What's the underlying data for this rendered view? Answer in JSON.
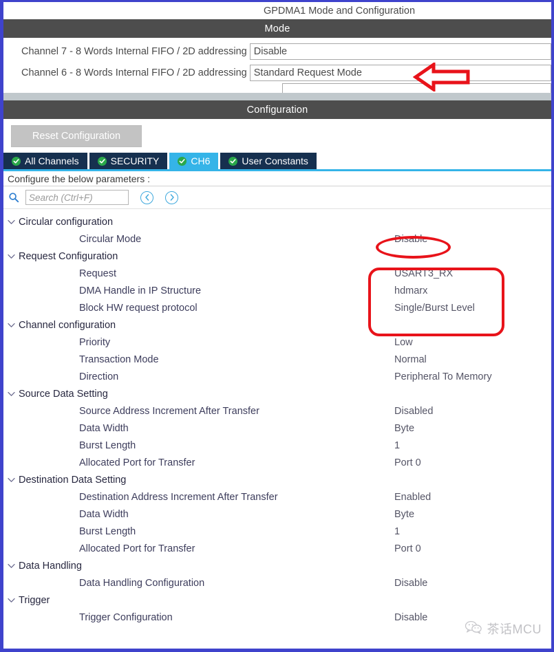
{
  "window": {
    "title": "GPDMA1 Mode and Configuration"
  },
  "mode_section": {
    "header": "Mode",
    "rows": [
      {
        "label": "Channel 7  - 8 Words Internal FIFO / 2D addressing",
        "value": "Disable"
      },
      {
        "label": "Channel 6  - 8 Words Internal FIFO / 2D addressing",
        "value": "Standard Request Mode"
      },
      {
        "label": "",
        "value": ""
      }
    ]
  },
  "configuration_section": {
    "header": "Configuration",
    "reset_button": "Reset Configuration",
    "tabs": [
      {
        "label": "All Channels",
        "icon": "check-circle-icon",
        "active": false
      },
      {
        "label": "SECURITY",
        "icon": "check-circle-icon",
        "active": false
      },
      {
        "label": "CH6",
        "icon": "check-circle-icon",
        "active": true
      },
      {
        "label": "User Constants",
        "icon": "check-circle-icon",
        "active": false
      }
    ],
    "hint": "Configure the below parameters :",
    "search": {
      "icon": "search-icon",
      "placeholder": "Search (Ctrl+F)",
      "value": "",
      "prev_icon": "chevron-left-icon",
      "next_icon": "chevron-right-icon"
    }
  },
  "parameters": [
    {
      "type": "group",
      "name": "Circular configuration",
      "value": ""
    },
    {
      "type": "child",
      "name": "Circular Mode",
      "value": "Disable"
    },
    {
      "type": "group",
      "name": "Request Configuration",
      "value": ""
    },
    {
      "type": "child",
      "name": "Request",
      "value": "USART3_RX"
    },
    {
      "type": "child",
      "name": "DMA Handle in IP Structure",
      "value": "hdmarx"
    },
    {
      "type": "child",
      "name": "Block HW request protocol",
      "value": "Single/Burst Level"
    },
    {
      "type": "group",
      "name": "Channel configuration",
      "value": ""
    },
    {
      "type": "child",
      "name": "Priority",
      "value": "Low"
    },
    {
      "type": "child",
      "name": "Transaction Mode",
      "value": "Normal"
    },
    {
      "type": "child",
      "name": "Direction",
      "value": "Peripheral To Memory"
    },
    {
      "type": "group",
      "name": "Source Data Setting",
      "value": ""
    },
    {
      "type": "child",
      "name": "Source Address Increment After Transfer",
      "value": "Disabled"
    },
    {
      "type": "child",
      "name": "Data Width",
      "value": "Byte"
    },
    {
      "type": "child",
      "name": "Burst Length",
      "value": "1"
    },
    {
      "type": "child",
      "name": "Allocated Port for Transfer",
      "value": "Port 0"
    },
    {
      "type": "group",
      "name": "Destination Data Setting",
      "value": ""
    },
    {
      "type": "child",
      "name": "Destination Address Increment After Transfer",
      "value": "Enabled"
    },
    {
      "type": "child",
      "name": "Data Width",
      "value": "Byte"
    },
    {
      "type": "child",
      "name": "Burst Length",
      "value": "1"
    },
    {
      "type": "child",
      "name": "Allocated Port for Transfer",
      "value": "Port 0"
    },
    {
      "type": "group",
      "name": "Data Handling",
      "value": ""
    },
    {
      "type": "child",
      "name": "Data Handling Configuration",
      "value": "Disable"
    },
    {
      "type": "group",
      "name": "Trigger",
      "value": ""
    },
    {
      "type": "child",
      "name": "Trigger Configuration",
      "value": "Disable"
    }
  ],
  "annotations": {
    "arrow": {
      "shape": "left-arrow",
      "color": "#e8131a",
      "target": "Standard Request Mode"
    },
    "ellipse": {
      "shape": "ellipse",
      "color": "#e8131a",
      "target": "Disable"
    },
    "rounded_rect": {
      "shape": "rounded-rectangle",
      "color": "#e8131a",
      "targets": [
        "USART3_RX",
        "hdmarx",
        "Single/Burst Level"
      ]
    }
  },
  "watermark": {
    "icon": "wechat-bubble-icon",
    "text": "茶话MCU"
  },
  "colors": {
    "frame_border": "#3f43cc",
    "section_header_bg": "#4d4d4d",
    "tab_inactive_bg": "#16304f",
    "tab_active_bg": "#35b4e8",
    "annotation_red": "#e8131a",
    "check_green": "#2aa84a"
  }
}
